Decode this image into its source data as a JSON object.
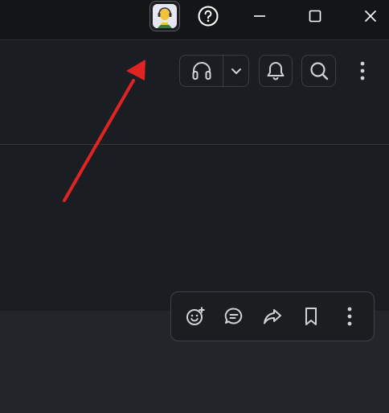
{
  "titlebar": {
    "avatar_icon": "user-avatar-headphones",
    "help_icon": "help-circle-icon",
    "minimize_icon": "minimize-icon",
    "maximize_icon": "maximize-icon",
    "close_icon": "close-icon"
  },
  "header": {
    "huddle_icon": "headphones-icon",
    "huddle_dropdown_icon": "chevron-down-icon",
    "notifications_icon": "bell-icon",
    "search_icon": "search-icon",
    "more_icon": "more-vertical-icon"
  },
  "message_actions": [
    {
      "icon": "add-reaction-icon"
    },
    {
      "icon": "reply-in-thread-icon"
    },
    {
      "icon": "forward-icon"
    },
    {
      "icon": "bookmark-icon"
    },
    {
      "icon": "more-vertical-icon"
    }
  ],
  "annotation": {
    "color": "#e02424",
    "shape": "arrow"
  },
  "colors": {
    "titlebar_bg": "#131517",
    "app_bg": "#1a1d21",
    "footer_bg": "#222529",
    "icon": "#d1d2d3",
    "border": "#3a3d42"
  }
}
